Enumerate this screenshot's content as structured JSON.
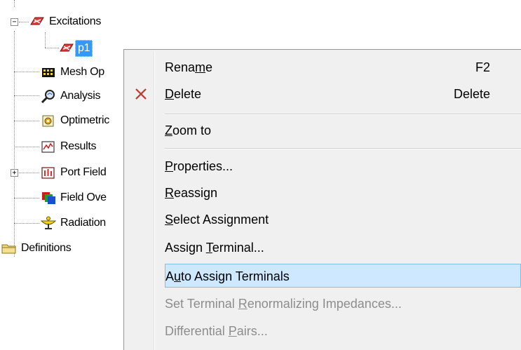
{
  "tree": {
    "items": [
      {
        "label": "Excitations",
        "icon": "excitations-icon",
        "expanded": true
      },
      {
        "label": "p1",
        "icon": "port-icon",
        "selected": true
      },
      {
        "label": "Mesh Op",
        "icon": "mesh-operations-icon"
      },
      {
        "label": "Analysis",
        "icon": "analysis-icon"
      },
      {
        "label": "Optimetric",
        "icon": "optimetrics-icon"
      },
      {
        "label": "Results",
        "icon": "results-icon"
      },
      {
        "label": "Port Field",
        "icon": "port-field-icon",
        "collapsed": true
      },
      {
        "label": "Field Ove",
        "icon": "field-overlays-icon"
      },
      {
        "label": "Radiation",
        "icon": "radiation-icon"
      },
      {
        "label": "Definitions",
        "icon": "folder-icon"
      }
    ]
  },
  "context_menu": {
    "items": [
      {
        "label_pre": "Rena",
        "mnemonic": "m",
        "label_post": "e",
        "shortcut": "F2",
        "enabled": true
      },
      {
        "label_pre": "",
        "mnemonic": "D",
        "label_post": "elete",
        "shortcut": "Delete",
        "enabled": true,
        "icon": "delete-x-icon"
      },
      {
        "label_pre": "",
        "mnemonic": "Z",
        "label_post": "oom to",
        "shortcut": "",
        "enabled": true
      },
      {
        "label_pre": "",
        "mnemonic": "P",
        "label_post": "roperties...",
        "shortcut": "",
        "enabled": true
      },
      {
        "label_pre": "",
        "mnemonic": "R",
        "label_post": "eassign",
        "shortcut": "",
        "enabled": true
      },
      {
        "label_pre": "",
        "mnemonic": "S",
        "label_post": "elect Assignment",
        "shortcut": "",
        "enabled": true
      },
      {
        "label_pre": "Assign ",
        "mnemonic": "T",
        "label_post": "erminal...",
        "shortcut": "",
        "enabled": true
      },
      {
        "label_pre": "A",
        "mnemonic": "u",
        "label_post": "to Assign Terminals",
        "shortcut": "",
        "enabled": true,
        "hovered": true
      },
      {
        "label_pre": "Set Terminal ",
        "mnemonic": "R",
        "label_post": "enormalizing Impedances...",
        "shortcut": "",
        "enabled": false
      },
      {
        "label_pre": "Differential ",
        "mnemonic": "P",
        "label_post": "airs...",
        "shortcut": "",
        "enabled": false
      }
    ]
  },
  "colors": {
    "selection": "#3399ff",
    "menu_background": "#f0f0f0",
    "menu_hover": "#cde8ff",
    "menu_hover_border": "#7fbfe8",
    "disabled_text": "#8d8d8d",
    "delete_icon": "#c0392b"
  }
}
